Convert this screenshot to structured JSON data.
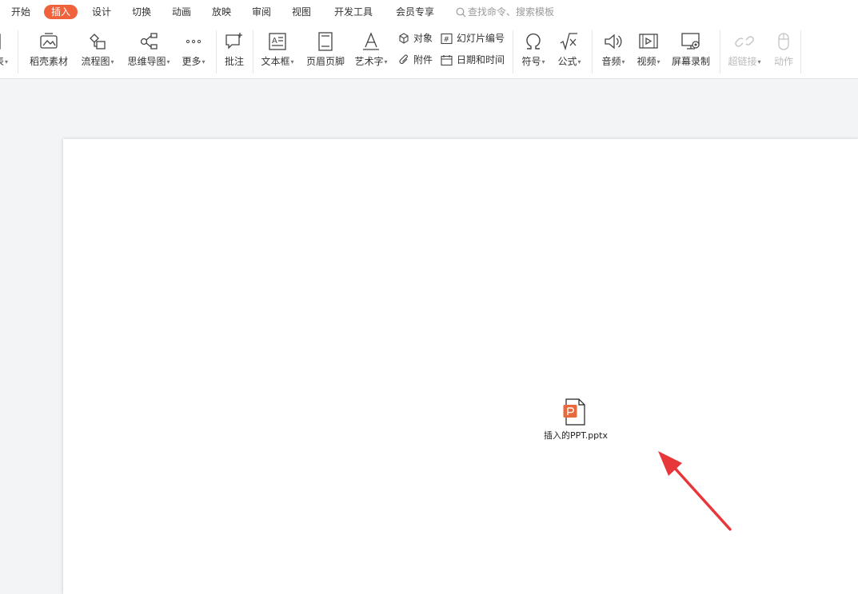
{
  "menu": {
    "tabs": [
      "开始",
      "插入",
      "设计",
      "切换",
      "动画",
      "放映",
      "审阅",
      "视图",
      "开发工具",
      "会员专享"
    ],
    "active_tab": "插入",
    "search_placeholder": "查找命令、搜索模板"
  },
  "ribbon": {
    "partial_left": "表",
    "daoke": "稻壳素材",
    "flowchart": "流程图",
    "mindmap": "思维导图",
    "more": "更多",
    "comment": "批注",
    "textbox": "文本框",
    "header_footer": "页眉页脚",
    "wordart": "艺术字",
    "object": "对象",
    "attachment": "附件",
    "slide_number": "幻灯片编号",
    "date_time": "日期和时间",
    "symbol": "符号",
    "formula": "公式",
    "audio": "音频",
    "video": "视频",
    "screen_record": "屏幕录制",
    "hyperlink": "超链接",
    "action": "动作"
  },
  "slide": {
    "embedded_file": "插入的PPT.pptx"
  },
  "colors": {
    "accent": "#f0623c",
    "arrow": "#e8373a",
    "file_icon": "#e9693c"
  }
}
